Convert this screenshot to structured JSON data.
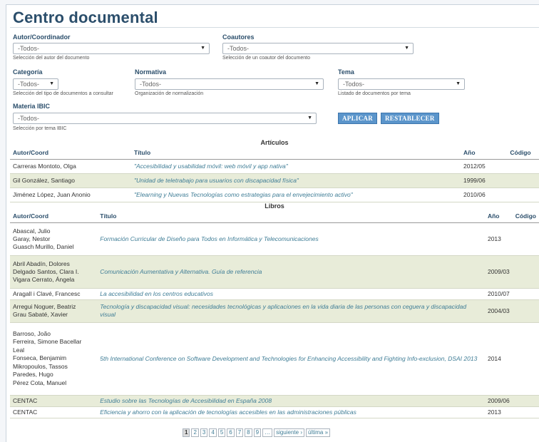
{
  "page_title": "Centro documental",
  "filters": {
    "autor": {
      "label": "Autor/Coordinador",
      "value": "-Todos-",
      "help": "Selección del autor del documento"
    },
    "coautores": {
      "label": "Coautores",
      "value": "-Todos-",
      "help": "Selección de un coautor del documento"
    },
    "categoria": {
      "label": "Categoría",
      "value": "-Todos-",
      "help": "Selección del tipo de documentos a consultar"
    },
    "normativa": {
      "label": "Normativa",
      "value": "-Todos-",
      "help": "Organización de normalización"
    },
    "tema": {
      "label": "Tema",
      "value": "-Todos-",
      "help": "Listado de documentos por tema"
    },
    "materia": {
      "label": "Materia IBIC",
      "value": "-Todos-",
      "help": "Selección por tema IBIC"
    }
  },
  "buttons": {
    "aplicar": "APLICAR",
    "restablecer": "RESTABLECER"
  },
  "articulos": {
    "heading": "Artículos",
    "columns": [
      "Autor/Coord",
      "Título",
      "Año",
      "Código"
    ],
    "rows": [
      {
        "author": "Carreras Montoto, Olga",
        "title": "\"Accesibilidad y usabilidad móvil: web móvil y app nativa\"",
        "year": "2012/05",
        "code": ""
      },
      {
        "author": "Gil González, Santiago",
        "title": "\"Unidad de teletrabajo para usuarios con discapacidad física\"",
        "year": "1999/06",
        "code": ""
      },
      {
        "author": "Jiménez López, Juan Anonio",
        "title": "\"Elearning y Nuevas Tecnologías como estrategias para el envejecimiento activo\"",
        "year": "2010/06",
        "code": ""
      }
    ]
  },
  "libros": {
    "heading": "Libros",
    "columns": [
      "Autor/Coord",
      "Título",
      "Año",
      "Código"
    ],
    "rows": [
      {
        "authors": [
          "Abascal, Julio",
          "Garay, Nestor",
          "Guasch Murillo, Daniel"
        ],
        "title": "Formación Curricular de Diseño para Todos en Informática y Telecomunicaciones",
        "year": "2013",
        "code": ""
      },
      {
        "authors": [
          "Abril Abadín, Dolores",
          "Delgado Santos, Clara I.",
          "Vigara Cerrato, Ángela"
        ],
        "title": "Comunicación Aumentativa y Alternativa. Guía de referencia",
        "year": "2009/03",
        "code": ""
      },
      {
        "authors": [
          "Aragall i Clavé, Francesc"
        ],
        "title": "La accesibilidad en los centros educativos",
        "year": "2010/07",
        "code": ""
      },
      {
        "authors": [
          "Arregui Noguer, Beatriz",
          "Grau Sabaté, Xavier"
        ],
        "title": "Tecnología y discapacidad visual: necesidades tecnológicas y aplicaciones en la vida diaria de las personas con ceguera y discapacidad visual",
        "year": "2004/03",
        "code": ""
      },
      {
        "authors": [
          "Barroso, João",
          "Ferreira, Simone Bacellar",
          "Leal",
          "Fonseca, Benjamim",
          "Mikropoulos, Tassos",
          "Paredes, Hugo",
          "Pérez Cota, Manuel"
        ],
        "title": "5th International Conference on Software Development and Technologies for Enhancing Accessibility and Fighting Info-exclusion, DSAI 2013",
        "year": "2014",
        "code": ""
      },
      {
        "authors": [
          "CENTAC"
        ],
        "title": "Estudio sobre las Tecnologías de Accesibilidad en España 2008",
        "year": "2009/06",
        "code": ""
      },
      {
        "authors": [
          "CENTAC"
        ],
        "title": "Eficiencia y ahorro con la aplicación de tecnologías accesibles en las administraciones públicas",
        "year": "2013",
        "code": ""
      }
    ]
  },
  "pager": {
    "pages": [
      "1",
      "2",
      "3",
      "4",
      "5",
      "6",
      "7",
      "8",
      "9",
      "…"
    ],
    "current": "1",
    "next": "siguiente ›",
    "last": "última »"
  }
}
